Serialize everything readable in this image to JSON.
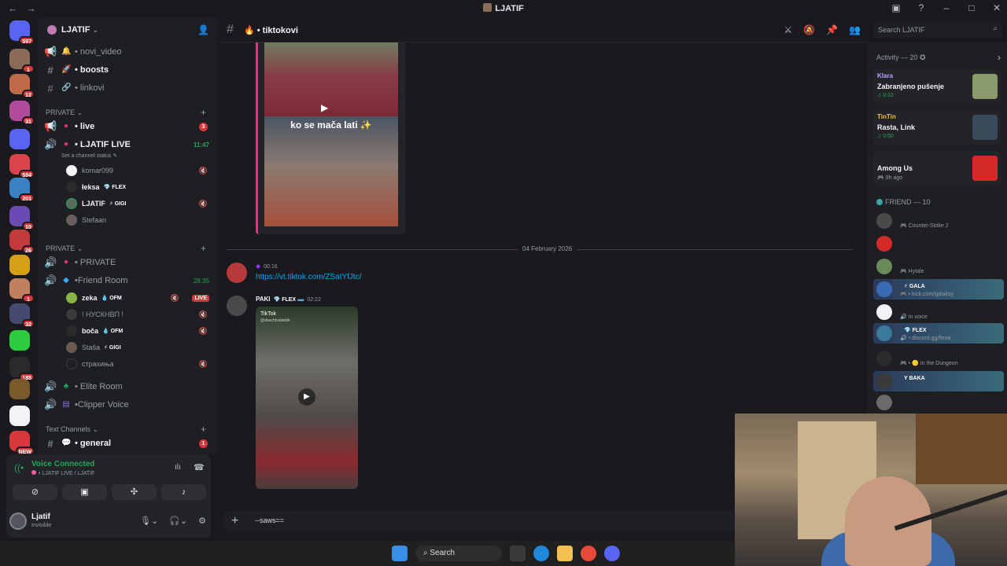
{
  "window": {
    "title": "LJATIF"
  },
  "server": {
    "name": "LJATIF"
  },
  "rail": [
    {
      "badge": "597",
      "color": "#5865f2"
    },
    {
      "badge": "1",
      "color": "#8a6b58"
    },
    {
      "badge": "12",
      "color": "#c06a4a"
    },
    {
      "badge": "31",
      "color": "#b04a9a"
    },
    {
      "badge": "",
      "color": "#5865f2"
    },
    {
      "badge": "594",
      "color": "#d9454a"
    },
    {
      "badge": "201",
      "color": "#3a82c4"
    },
    {
      "badge": "10",
      "color": "#6b4ab4"
    },
    {
      "badge": "26",
      "color": "#c23a3a"
    },
    {
      "badge": "",
      "color": "#d4a017"
    },
    {
      "badge": "1",
      "color": "#c08060"
    },
    {
      "badge": "32",
      "color": "#444b6e"
    },
    {
      "badge": "",
      "color": "#2ecc40"
    },
    {
      "badge": "185",
      "color": "#2a2a2a"
    },
    {
      "badge": "",
      "color": "#7a5a2a"
    },
    {
      "badge": "",
      "color": "#f2f3f5"
    },
    {
      "badge": "NEW",
      "color": "#da373c"
    }
  ],
  "channels": {
    "top": [
      {
        "name": "• novi_video",
        "emoji": "🔔"
      },
      {
        "name": "• boosts",
        "emoji": "🚀"
      },
      {
        "name": "• linkovi",
        "emoji": "🔗"
      }
    ],
    "cat_private1": "PRIVATE",
    "live": {
      "name": "• live",
      "badge": "3"
    },
    "ljatif_live": {
      "name": "• LJATIF LIVE",
      "time": "11:47",
      "status": "Set a channel status"
    },
    "live_users": [
      {
        "name": "komar099",
        "tag": ""
      },
      {
        "name": "łeksa",
        "tag": "💎 FLEX"
      },
      {
        "name": "LJATIF",
        "tag": "⚡ GIGI"
      },
      {
        "name": "Stefaan",
        "tag": ""
      }
    ],
    "cat_private2": "PRIVATE",
    "private_ch": "• PRIVATE",
    "friend_room": {
      "name": "•Friend Room",
      "time": "28:35"
    },
    "friend_users": [
      {
        "name": "zeka",
        "tag": "💧 OFM",
        "live": "LIVE"
      },
      {
        "name": "! НУСКНВП !",
        "tag": ""
      },
      {
        "name": "boča",
        "tag": "💧 OFM"
      },
      {
        "name": "Staša",
        "tag": "⚡ GIGI"
      },
      {
        "name": "страхиња",
        "tag": ""
      }
    ],
    "elite": "• Elite Room",
    "clipper": "•Clipper Voice",
    "cat_text": "Text Channels",
    "general": {
      "name": "• general",
      "badge": "1"
    }
  },
  "voice": {
    "status": "Voice Connected",
    "channel": "• LJATIF LIVE / LJATIF"
  },
  "user": {
    "name": "Ljatif",
    "status": "Invisible"
  },
  "chat": {
    "channel": "• tiktokovi",
    "caption": "ko se mača lati ✨",
    "date": "04 February 2026",
    "msg1": {
      "author": "",
      "time": "00:16",
      "link": "https://vt.tiktok.com/ZSatYfJtc/"
    },
    "msg2": {
      "author": "PAKI",
      "tag": "💎 FLEX",
      "time": "02:22"
    },
    "tiktok_label": "TikTok",
    "tiktok_handle": "@dnechtvoitetde",
    "composer_text": "--saws=="
  },
  "search": {
    "placeholder": "Search LJATIF"
  },
  "activity": {
    "header": "Activity — 20 ✪",
    "cards": [
      {
        "name": "Klara",
        "game": "Zabranjeno pušenje",
        "time": "♫ 0:32",
        "color": "#c0a0ff"
      },
      {
        "name": "TinTin",
        "game": "Rasta, Link",
        "time": "♫ 0:50",
        "color": "#f0c030"
      },
      {
        "name": "",
        "game": "Among Us",
        "time": "🎮 9h ago",
        "color": "#5865f2"
      }
    ]
  },
  "friends": {
    "header": "FRIEND — 10",
    "list": [
      {
        "name": "",
        "sub": "🎮 Counter-Strike 2",
        "tag": "",
        "color": "#6b6bff"
      },
      {
        "name": "",
        "sub": "",
        "tag": "",
        "color": "#5b5bff"
      },
      {
        "name": "",
        "sub": "🎮 Hytale",
        "tag": "",
        "color": "#6b6bff"
      },
      {
        "name": "",
        "sub": "🎮 • kick.com/galaksy",
        "tag": "⚡ GALA",
        "color": "#6b6bff"
      },
      {
        "name": "",
        "sub": "🔊 In voice",
        "tag": "",
        "color": "#6b6bff"
      },
      {
        "name": "",
        "sub": "🔊 • discord.gg/flexa",
        "tag": "💎 FLEX",
        "color": "#6b6bff"
      },
      {
        "name": "",
        "sub": "🎮 • 🟡 In the Dungeon",
        "tag": "",
        "color": "#6b6bff"
      },
      {
        "name": "",
        "sub": "",
        "tag": "Y BAKA",
        "color": "#6b6bff"
      },
      {
        "name": "",
        "sub": "",
        "tag": "",
        "color": "#6b6bff"
      }
    ]
  },
  "taskbar": {
    "search": "Search"
  }
}
